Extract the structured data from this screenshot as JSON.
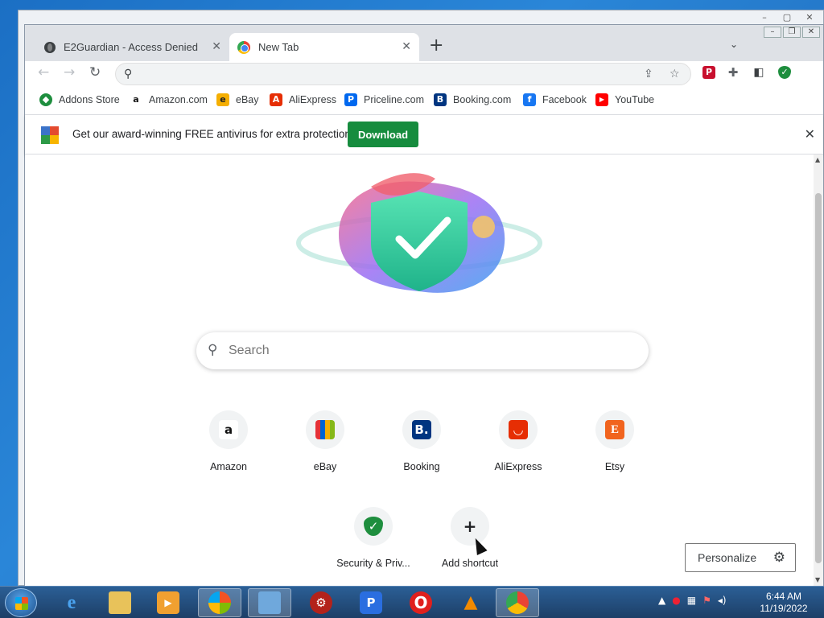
{
  "browser": {
    "tabs": [
      {
        "title": "E2Guardian - Access Denied"
      },
      {
        "title": "New Tab"
      }
    ],
    "omnibox": {
      "value": "",
      "placeholder": ""
    }
  },
  "bookmarks": [
    {
      "label": "Addons Store",
      "icon": "addons-store-icon",
      "color": "#1e8e3e"
    },
    {
      "label": "Amazon.com",
      "icon": "amazon-icon",
      "color": "#ffffff"
    },
    {
      "label": "eBay",
      "icon": "ebay-icon",
      "color": "#f5af02"
    },
    {
      "label": "AliExpress",
      "icon": "aliexpress-icon",
      "color": "#e62e04"
    },
    {
      "label": "Priceline.com",
      "icon": "priceline-icon",
      "color": "#0068ef"
    },
    {
      "label": "Booking.com",
      "icon": "booking-icon",
      "color": "#003580"
    },
    {
      "label": "Facebook",
      "icon": "facebook-icon",
      "color": "#1877f2"
    },
    {
      "label": "YouTube",
      "icon": "youtube-icon",
      "color": "#ff0000"
    }
  ],
  "infobar": {
    "text": "Get our award-winning FREE antivirus for extra protection",
    "button": "Download"
  },
  "ntp": {
    "search_placeholder": "Search",
    "shortcuts": [
      {
        "label": "Amazon"
      },
      {
        "label": "eBay"
      },
      {
        "label": "Booking"
      },
      {
        "label": "AliExpress"
      },
      {
        "label": "Etsy"
      },
      {
        "label": "Security & Priv..."
      },
      {
        "label": "Add shortcut"
      }
    ],
    "personalize": "Personalize"
  },
  "taskbar": {
    "time": "6:44 AM",
    "date": "11/19/2022"
  },
  "colors": {
    "download_button": "#168c3e",
    "taskbar": "#2b5f96"
  }
}
